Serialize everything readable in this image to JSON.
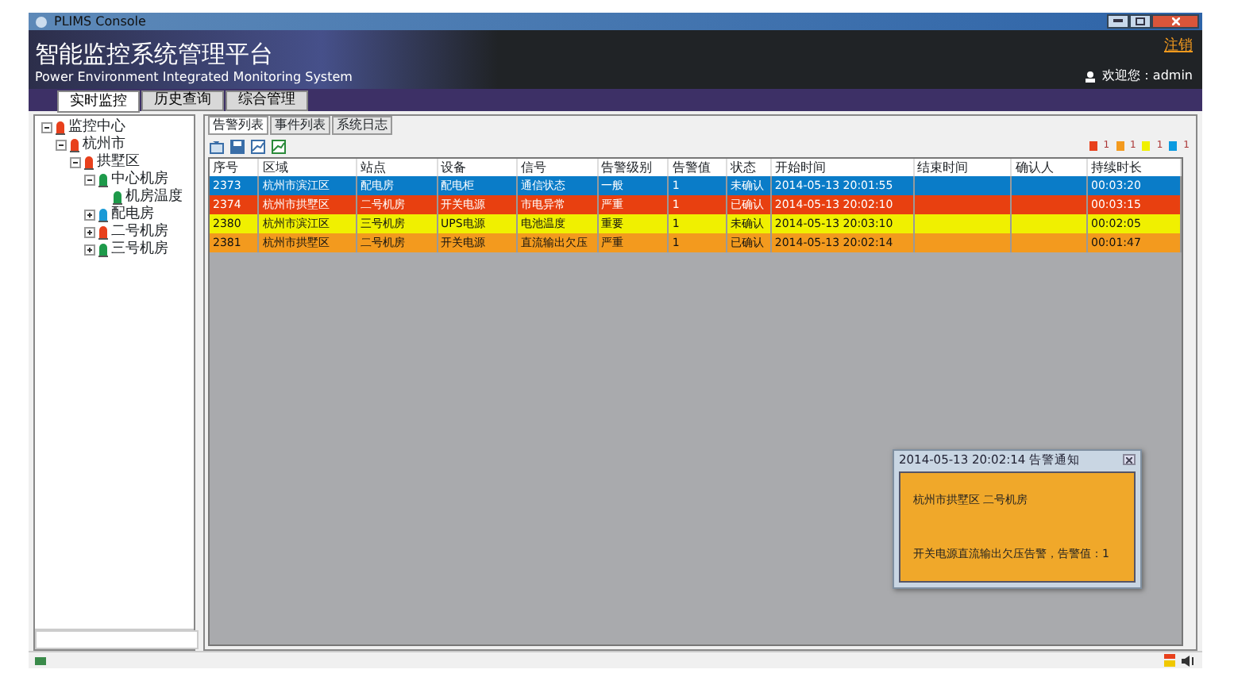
{
  "window": {
    "title": "PLIMS Console"
  },
  "header": {
    "title": "智能监控系统管理平台",
    "subtitle": "Power Environment Integrated Monitoring System",
    "logout": "注销",
    "user": "欢迎您：admin"
  },
  "main_tabs": [
    {
      "label": "实时监控",
      "selected": true
    },
    {
      "label": "历史查询",
      "selected": false
    },
    {
      "label": "综合管理",
      "selected": false
    }
  ],
  "tree": [
    {
      "label": "监控中心",
      "color": "#e8401c",
      "expanded": true,
      "children": [
        {
          "label": "杭州市",
          "color": "#e8401c",
          "expanded": true,
          "children": [
            {
              "label": "拱墅区",
              "color": "#e8401c",
              "expanded": true,
              "children": [
                {
                  "label": "中心机房",
                  "color": "#1e9a4a",
                  "expanded": true,
                  "children": [
                    {
                      "label": "机房温度",
                      "color": "#1e9a4a"
                    }
                  ]
                },
                {
                  "label": "配电房",
                  "color": "#1b9ad6",
                  "expanded": false
                },
                {
                  "label": "二号机房",
                  "color": "#e8401c",
                  "expanded": false
                },
                {
                  "label": "三号机房",
                  "color": "#1e9a4a",
                  "expanded": false
                }
              ]
            }
          ]
        }
      ]
    }
  ],
  "sub_tabs": [
    {
      "label": "告警列表",
      "selected": true
    },
    {
      "label": "事件列表",
      "selected": false
    },
    {
      "label": "系统日志",
      "selected": false
    }
  ],
  "legend": [
    {
      "color": "#e8401c",
      "count": "1"
    },
    {
      "color": "#f39a1e",
      "count": "1"
    },
    {
      "color": "#f0f000",
      "count": "1"
    },
    {
      "color": "#0a9ae0",
      "count": "1"
    }
  ],
  "table": {
    "columns": [
      "序号",
      "区域",
      "站点",
      "设备",
      "信号",
      "告警级别",
      "告警值",
      "状态",
      "开始时间",
      "结束时间",
      "确认人",
      "持续时长"
    ],
    "rows": [
      {
        "color": "#0a7cc8",
        "cells": [
          "2373",
          "杭州市滨江区",
          "配电房",
          "配电柜",
          "通信状态",
          "一般",
          "1",
          "未确认",
          "2014-05-13 20:01:55",
          "",
          "",
          "00:03:20"
        ]
      },
      {
        "color": "#e84010",
        "cells": [
          "2374",
          "杭州市拱墅区",
          "二号机房",
          "开关电源",
          "市电异常",
          "严重",
          "1",
          "已确认",
          "2014-05-13 20:02:10",
          "",
          "",
          "00:03:15"
        ]
      },
      {
        "color": "#f0f000",
        "cells": [
          "2380",
          "杭州市滨江区",
          "三号机房",
          "UPS电源",
          "电池温度",
          "重要",
          "1",
          "未确认",
          "2014-05-13 20:03:10",
          "",
          "",
          "00:02:05"
        ]
      },
      {
        "color": "#f39a1e",
        "cells": [
          "2381",
          "杭州市拱墅区",
          "二号机房",
          "开关电源",
          "直流输出欠压",
          "严重",
          "1",
          "已确认",
          "2014-05-13 20:02:14",
          "",
          "",
          "00:01:47"
        ]
      }
    ]
  },
  "popup": {
    "title": "2014-05-13 20:02:14 告警通知",
    "location": "杭州市拱墅区 二号机房",
    "message": "开关电源直流输出欠压告警，告警值：1"
  }
}
